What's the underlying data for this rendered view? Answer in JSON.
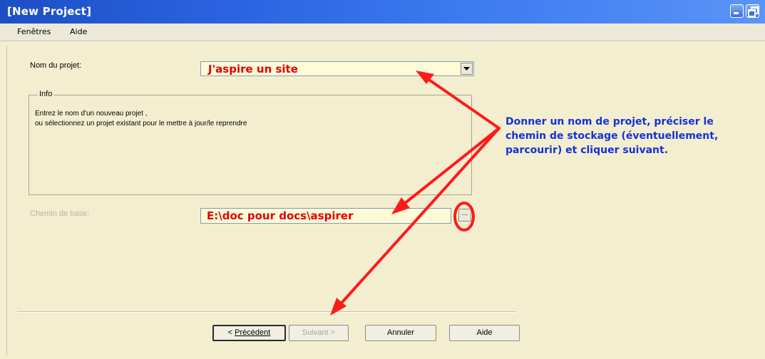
{
  "window": {
    "title": "[New Project]"
  },
  "menu": {
    "items": [
      "Fenêtres",
      "Aide"
    ]
  },
  "form": {
    "project_name_label": "Nom du projet:",
    "project_name_value": "J'aspire un site",
    "info_legend": "Info",
    "info_lines": [
      "Entrez le nom d'un nouveau projet ,",
      "ou sélectionnez un projet existant pour le mettre à jour/le reprendre"
    ],
    "base_path_label": "Chemin de base:",
    "base_path_value": "E:\\doc pour docs\\aspirer",
    "browse_label": "..."
  },
  "buttons": {
    "prev_prefix": "< ",
    "prev_label": "Précédent",
    "next": "Suivant >",
    "cancel": "Annuler",
    "help": "Aide"
  },
  "annotation": {
    "lines": [
      "Donner un nom de projet, préciser le",
      "chemin de stockage (éventuellement,",
      "parcourir) et cliquer suivant."
    ],
    "color": "#1432d8"
  },
  "colors": {
    "title_bar": "#2a63e2",
    "highlight": "#e0000a",
    "field_background": "#fffbd7",
    "panel_background": "#f4eed0"
  }
}
